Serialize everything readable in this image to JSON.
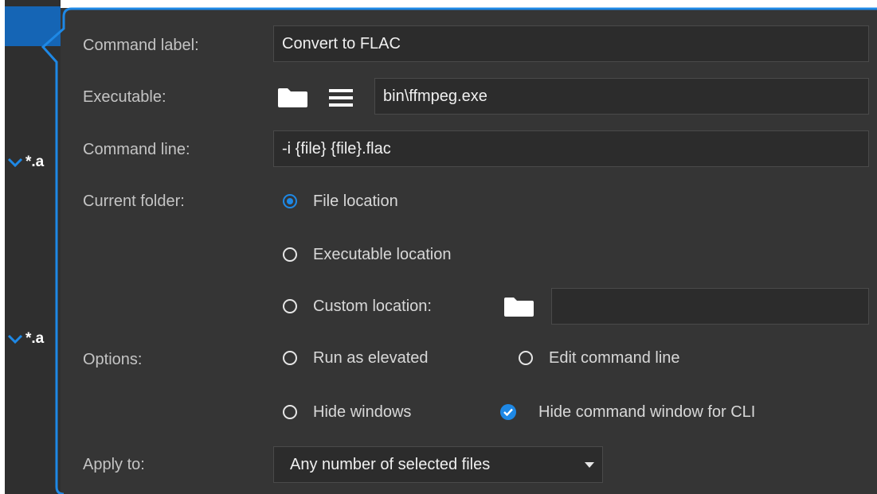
{
  "ext_list": {
    "items": [
      "*.a",
      "*.a"
    ]
  },
  "form": {
    "command_label": {
      "label": "Command label:",
      "value": "Convert to FLAC"
    },
    "executable": {
      "label": "Executable:",
      "value": "bin\\ffmpeg.exe",
      "browse_icon": "folder-icon",
      "list_icon": "list-icon"
    },
    "command_line": {
      "label": "Command line:",
      "value": "-i {file} {file}.flac"
    },
    "current_folder": {
      "label": "Current folder:",
      "options": [
        {
          "label": "File location",
          "selected": true
        },
        {
          "label": "Executable location",
          "selected": false
        },
        {
          "label": "Custom location:",
          "selected": false
        }
      ],
      "custom_value": ""
    },
    "options": {
      "label": "Options:",
      "run_as_elevated": {
        "label": "Run as elevated",
        "checked": false
      },
      "edit_command_line": {
        "label": "Edit command line",
        "checked": false
      },
      "hide_windows": {
        "label": "Hide windows",
        "checked": false
      },
      "hide_command_window": {
        "label": "Hide command window for CLI",
        "checked": true
      }
    },
    "apply_to": {
      "label": "Apply to:",
      "value": "Any number of selected files"
    }
  },
  "colors": {
    "accent": "#1e88e5",
    "panel": "#353535",
    "field": "#2c2c2c",
    "selection": "#1565b5"
  }
}
